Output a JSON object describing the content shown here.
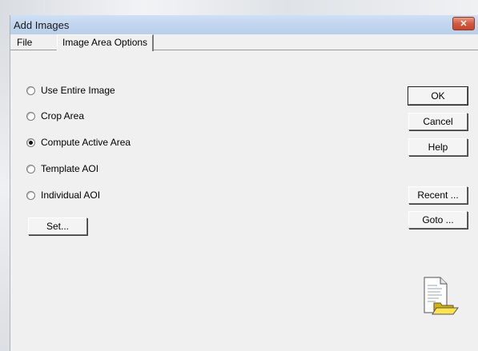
{
  "dialog": {
    "title": "Add Images",
    "close_label": "✕"
  },
  "tabs": [
    {
      "label": "File"
    },
    {
      "label": "Image Area Options"
    }
  ],
  "options": [
    {
      "label": "Use Entire Image",
      "checked": false
    },
    {
      "label": "Crop Area",
      "checked": false
    },
    {
      "label": "Compute Active Area",
      "checked": true
    },
    {
      "label": "Template AOI",
      "checked": false
    },
    {
      "label": "Individual AOI",
      "checked": false
    }
  ],
  "buttons": {
    "set": "Set...",
    "ok": "OK",
    "cancel": "Cancel",
    "help": "Help",
    "recent": "Recent ...",
    "goto": "Goto ..."
  },
  "icons": {
    "document_folder": "document-folder-icon",
    "close": "close-icon"
  },
  "colors": {
    "titlebar": "#c2d6ee",
    "close_button": "#d25a3e",
    "dialog_bg": "#f0f0f0"
  }
}
